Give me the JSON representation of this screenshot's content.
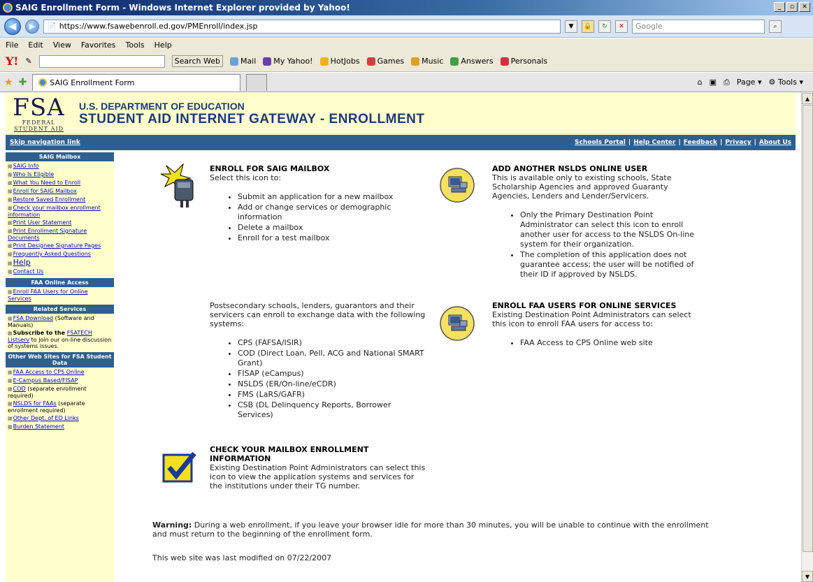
{
  "window": {
    "title": "SAIG Enrollment Form - Windows Internet Explorer provided by Yahoo!",
    "url": "https://www.fsawebenroll.ed.gov/PMEnroll/index.jsp",
    "search_placeholder": "Google"
  },
  "menu": [
    "File",
    "Edit",
    "View",
    "Favorites",
    "Tools",
    "Help"
  ],
  "yahoo_toolbar": {
    "logo": "Y!",
    "search_btn": "Search Web",
    "items": [
      "Mail",
      "My Yahoo!",
      "HotJobs",
      "Games",
      "Music",
      "Answers",
      "Personals"
    ]
  },
  "tab": {
    "label": "SAIG Enrollment Form",
    "page_menu": "Page",
    "tools_menu": "Tools"
  },
  "header": {
    "logo_big": "FSA",
    "logo_small1": "FEDERAL",
    "logo_small2": "STUDENT AID",
    "dept": "U.S. DEPARTMENT OF EDUCATION",
    "title": "STUDENT AID INTERNET GATEWAY - ENROLLMENT"
  },
  "navstrip": {
    "skip": "Skip navigation link",
    "links": [
      "Schools Portal",
      "Help Center",
      "Feedback",
      "Privacy",
      "About Us"
    ]
  },
  "leftnav": {
    "sections": [
      {
        "title": "SAIG Mailbox",
        "items": [
          {
            "text": "SAIG Info"
          },
          {
            "text": "Who Is Eligible"
          },
          {
            "text": "What You Need to Enroll"
          },
          {
            "text": "Enroll for SAIG Mailbox"
          },
          {
            "text": "Restore Saved Enrollment"
          },
          {
            "text": "Check your mailbox enrollment information"
          },
          {
            "text": "Print User Statement"
          },
          {
            "text": "Print Enrollment Signature Documents"
          },
          {
            "text": "Print Designee Signature Pages"
          },
          {
            "text": "Frequently Asked Questions"
          },
          {
            "text": "Help",
            "big": true
          },
          {
            "text": "Contact Us"
          }
        ]
      },
      {
        "title": "FAA Online Access",
        "items": [
          {
            "text": "Enroll FAA Users for Online Services"
          }
        ]
      },
      {
        "title": "Related Services",
        "items": [
          {
            "text": "FSA Download",
            "suffix": " (Software and Manuals)"
          },
          {
            "prefix": "Subscribe to the ",
            "text": "FSATECH Listserv",
            "suffix": " to join our on-line discussion of systems issues."
          }
        ]
      },
      {
        "title": "Other Web Sites for FSA Student Data",
        "items": [
          {
            "text": "FAA Access to CPS Online"
          },
          {
            "text": "E-Campus Based/FISAP"
          },
          {
            "text": "COD",
            "suffix": " (separate enrollment required)"
          },
          {
            "text": "NSLDS for FAAs",
            "suffix": " (separate enrollment required)"
          },
          {
            "text": "Other Dept. of ED Links"
          },
          {
            "text": "Burden Statement"
          }
        ]
      }
    ]
  },
  "enroll_mailbox": {
    "title": "ENROLL FOR SAIG MAILBOX",
    "intro": "Select this icon to:",
    "items": [
      "Submit an application for a new mailbox",
      "Add or change services or demographic information",
      "Delete a mailbox",
      "Enroll for a test mailbox"
    ]
  },
  "nslds_user": {
    "title": "ADD ANOTHER NSLDS ONLINE USER",
    "intro": "This is available only to existing schools, State Scholarship Agencies and approved Guaranty Agencies, Lenders and Lender/Servicers.",
    "items": [
      "Only the Primary Destination Point Administrator can select this icon to enroll another user for access to the NSLDS On-line system for their organization.",
      "The completion of this application does not guarantee access; the user will be notified of their ID if approved by NSLDS."
    ]
  },
  "systems": {
    "intro": "Postsecondary schools, lenders, guarantors and their servicers can enroll to exchange data with the following systems:",
    "items": [
      "CPS (FAFSA/ISIR)",
      "COD (Direct Loan, Pell, ACG and National SMART Grant)",
      "FISAP (eCampus)",
      "NSLDS (ER/On-line/eCDR)",
      "FMS (LaRS/GAFR)",
      "CSB (DL Delinquency Reports, Borrower Services)"
    ]
  },
  "faa_users": {
    "title": "ENROLL FAA USERS FOR ONLINE SERVICES",
    "intro": "Existing Destination Point Administrators can select this icon to enroll FAA users for access to:",
    "items": [
      "FAA Access to CPS Online web site"
    ]
  },
  "check_info": {
    "title": "CHECK YOUR MAILBOX ENROLLMENT INFORMATION",
    "intro": "Existing Destination Point Administrators can select this icon to view the application systems and services for the institutions under their TG number."
  },
  "footer": {
    "warning_label": "Warning:",
    "warning_text": " During a web enrollment, if you leave your browser idle for more than 30 minutes, you will be unable to continue with the enrollment and must return to the beginning of the enrollment form.",
    "modified": "This web site was last modified on 07/22/2007"
  }
}
